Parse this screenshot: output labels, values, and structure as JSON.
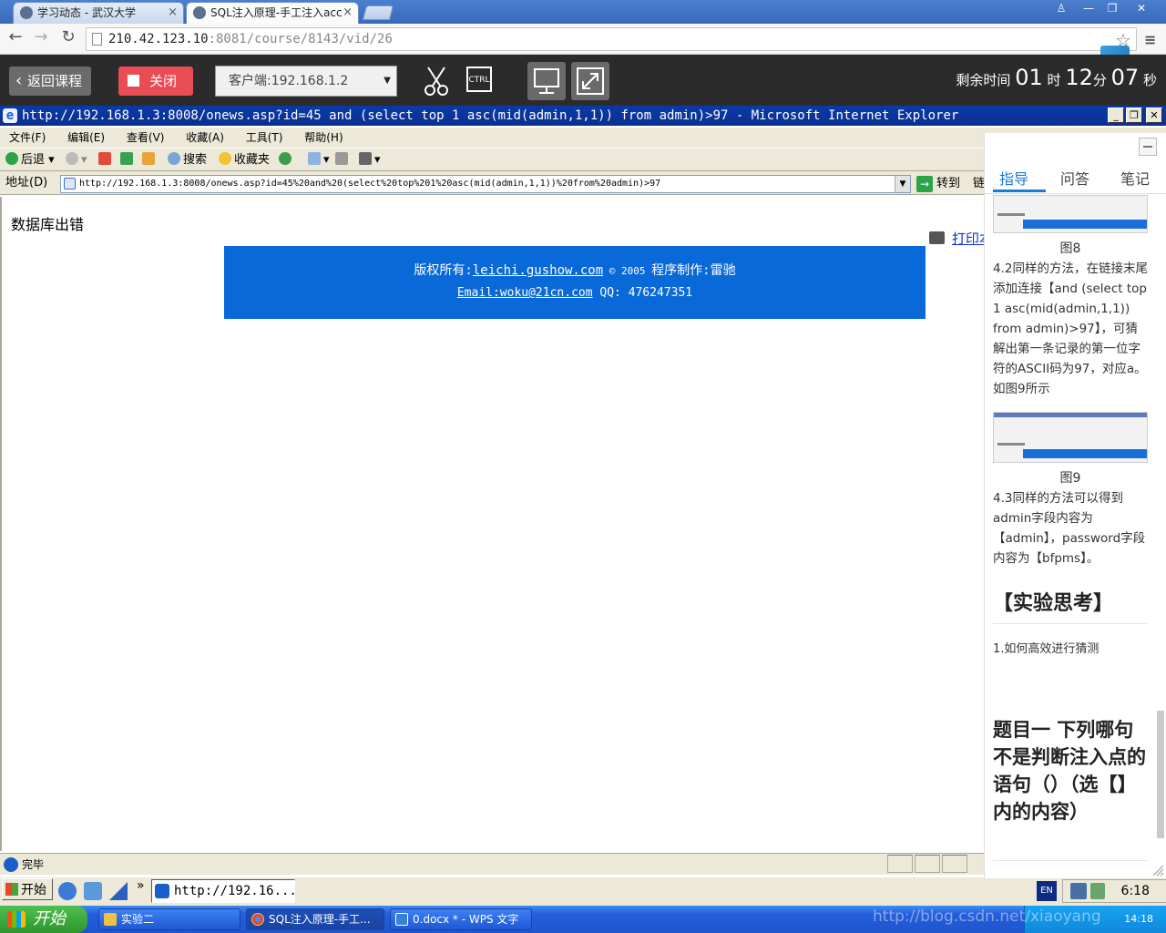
{
  "browser": {
    "tabs": [
      {
        "title": "学习动态 - 武汉大学"
      },
      {
        "title": "SQL注入原理-手工注入acc"
      }
    ],
    "url_host": "210.42.123.10",
    "url_rest": ":8081/course/8143/vid/26"
  },
  "course_toolbar": {
    "back_label": "返回课程",
    "close_label": "关闭",
    "client_label": "客户端:192.168.1.2",
    "timer_prefix": "剩余时间",
    "hours": "01",
    "hours_unit": "时",
    "minutes": "12",
    "minutes_unit": "分",
    "seconds": "07",
    "seconds_unit": "秒"
  },
  "ie": {
    "title": "http://192.168.1.3:8008/onews.asp?id=45 and (select top 1 asc(mid(admin,1,1)) from admin)>97 - Microsoft Internet Explorer",
    "menu": [
      "文件(F)",
      "编辑(E)",
      "查看(V)",
      "收藏(A)",
      "工具(T)",
      "帮助(H)"
    ],
    "toolbar": {
      "back": "后退",
      "search": "搜索",
      "favorites": "收藏夹"
    },
    "address_label": "地址(D)",
    "address": "http://192.168.1.3:8008/onews.asp?id=45%20and%20(select%20top%201%20asc(mid(admin,1,1))%20from%20admin)>97",
    "go_label": "转到",
    "links_label": "链",
    "status": "完毕"
  },
  "webpage": {
    "error_text": "数据库出错",
    "print_label": "打印本",
    "footer_line1_prefix": "版权所有:",
    "footer_link": "leichi.gushow.com",
    "footer_copy": " © 2005 ",
    "footer_author": "程序制作:雷驰",
    "footer_email": "Email:woku@21cn.com",
    "footer_qq": " QQ: 476247351"
  },
  "inner_taskbar": {
    "start": "开始",
    "ie_task": "http://192.16...",
    "lang": "EN",
    "clock": "6:18"
  },
  "host_taskbar": {
    "start": "开始",
    "tasks": [
      "实验二",
      "SQL注入原理-手工...",
      "0.docx * - WPS 文字"
    ],
    "clock": "14:18",
    "watermark": "http://blog.csdn.net/xiaoyang"
  },
  "guide": {
    "tabs": [
      "指导",
      "问答",
      "笔记"
    ],
    "fig8": "图8",
    "p42": "4.2同样的方法，在链接末尾添加连接【and (select top 1 asc(mid(admin,1,1)) from admin)>97】，可猜解出第一条记录的第一位字符的ASCII码为97，对应a。如图9所示",
    "fig9": "图9",
    "p43": "4.3同样的方法可以得到admin字段内容为【admin】，password字段内容为【bfpms】。",
    "think_heading": "【实验思考】",
    "think_q1": "1.如何高效进行猜测",
    "question_title": "题目一 下列哪句不是判断注入点的语句（）（选【】内的内容）"
  }
}
